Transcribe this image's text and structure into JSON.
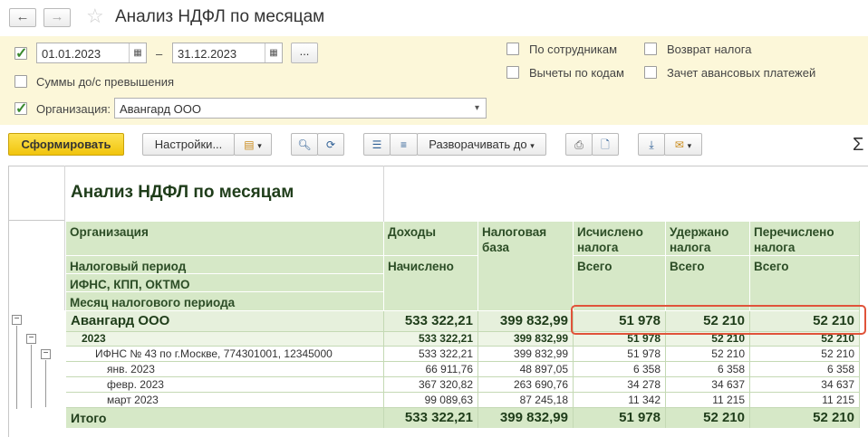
{
  "window": {
    "title": "Анализ НДФЛ по месяцам"
  },
  "nav": {
    "back": "←",
    "forward": "→"
  },
  "filters": {
    "date_from": "01.01.2023",
    "date_to": "31.12.2023",
    "dash": "–",
    "period_btn": "...",
    "amounts_label": "Суммы до/с превышения",
    "org_label": "Организация:",
    "org_value": "Авангард ООО",
    "by_employees": "По сотрудникам",
    "deductions_by_codes": "Вычеты по кодам",
    "tax_refund": "Возврат налога",
    "advance_offset": "Зачет авансовых платежей"
  },
  "toolbar": {
    "generate": "Сформировать",
    "settings": "Настройки...",
    "expand_to": "Разворачивать до"
  },
  "report": {
    "title": "Анализ НДФЛ по месяцам",
    "headers": {
      "organization": "Организация",
      "tax_period": "Налоговый период",
      "ifns": "ИФНС, КПП, ОКТМО",
      "month": "Месяц налогового периода",
      "income": "Доходы",
      "accrued": "Начислено",
      "tax_base": "Налоговая база",
      "calculated": "Исчислено налога",
      "withheld": "Удержано налога",
      "transferred": "Перечислено налога",
      "total_sub": "Всего"
    },
    "rows": [
      {
        "label": "Авангард ООО",
        "income": "533 322,21",
        "base": "399 832,99",
        "calc": "51 978",
        "withheld": "52 210",
        "transferred": "52 210"
      },
      {
        "label": "2023",
        "income": "533 322,21",
        "base": "399 832,99",
        "calc": "51 978",
        "withheld": "52 210",
        "transferred": "52 210"
      },
      {
        "label": "ИФНС № 43 по г.Москве, 774301001, 12345000",
        "income": "533 322,21",
        "base": "399 832,99",
        "calc": "51 978",
        "withheld": "52 210",
        "transferred": "52 210"
      },
      {
        "label": "янв. 2023",
        "income": "66 911,76",
        "base": "48 897,05",
        "calc": "6 358",
        "withheld": "6 358",
        "transferred": "6 358"
      },
      {
        "label": "февр. 2023",
        "income": "367 320,82",
        "base": "263 690,76",
        "calc": "34 278",
        "withheld": "34 637",
        "transferred": "34 637"
      },
      {
        "label": "март 2023",
        "income": "99 089,63",
        "base": "87 245,18",
        "calc": "11 342",
        "withheld": "11 215",
        "transferred": "11 215"
      }
    ],
    "total": {
      "label": "Итого",
      "income": "533 322,21",
      "base": "399 832,99",
      "calc": "51 978",
      "withheld": "52 210",
      "transferred": "52 210"
    }
  },
  "colors": {
    "accent": "#f1c40c",
    "header_bg": "#d6e8c7",
    "highlight": "#e0533a"
  }
}
